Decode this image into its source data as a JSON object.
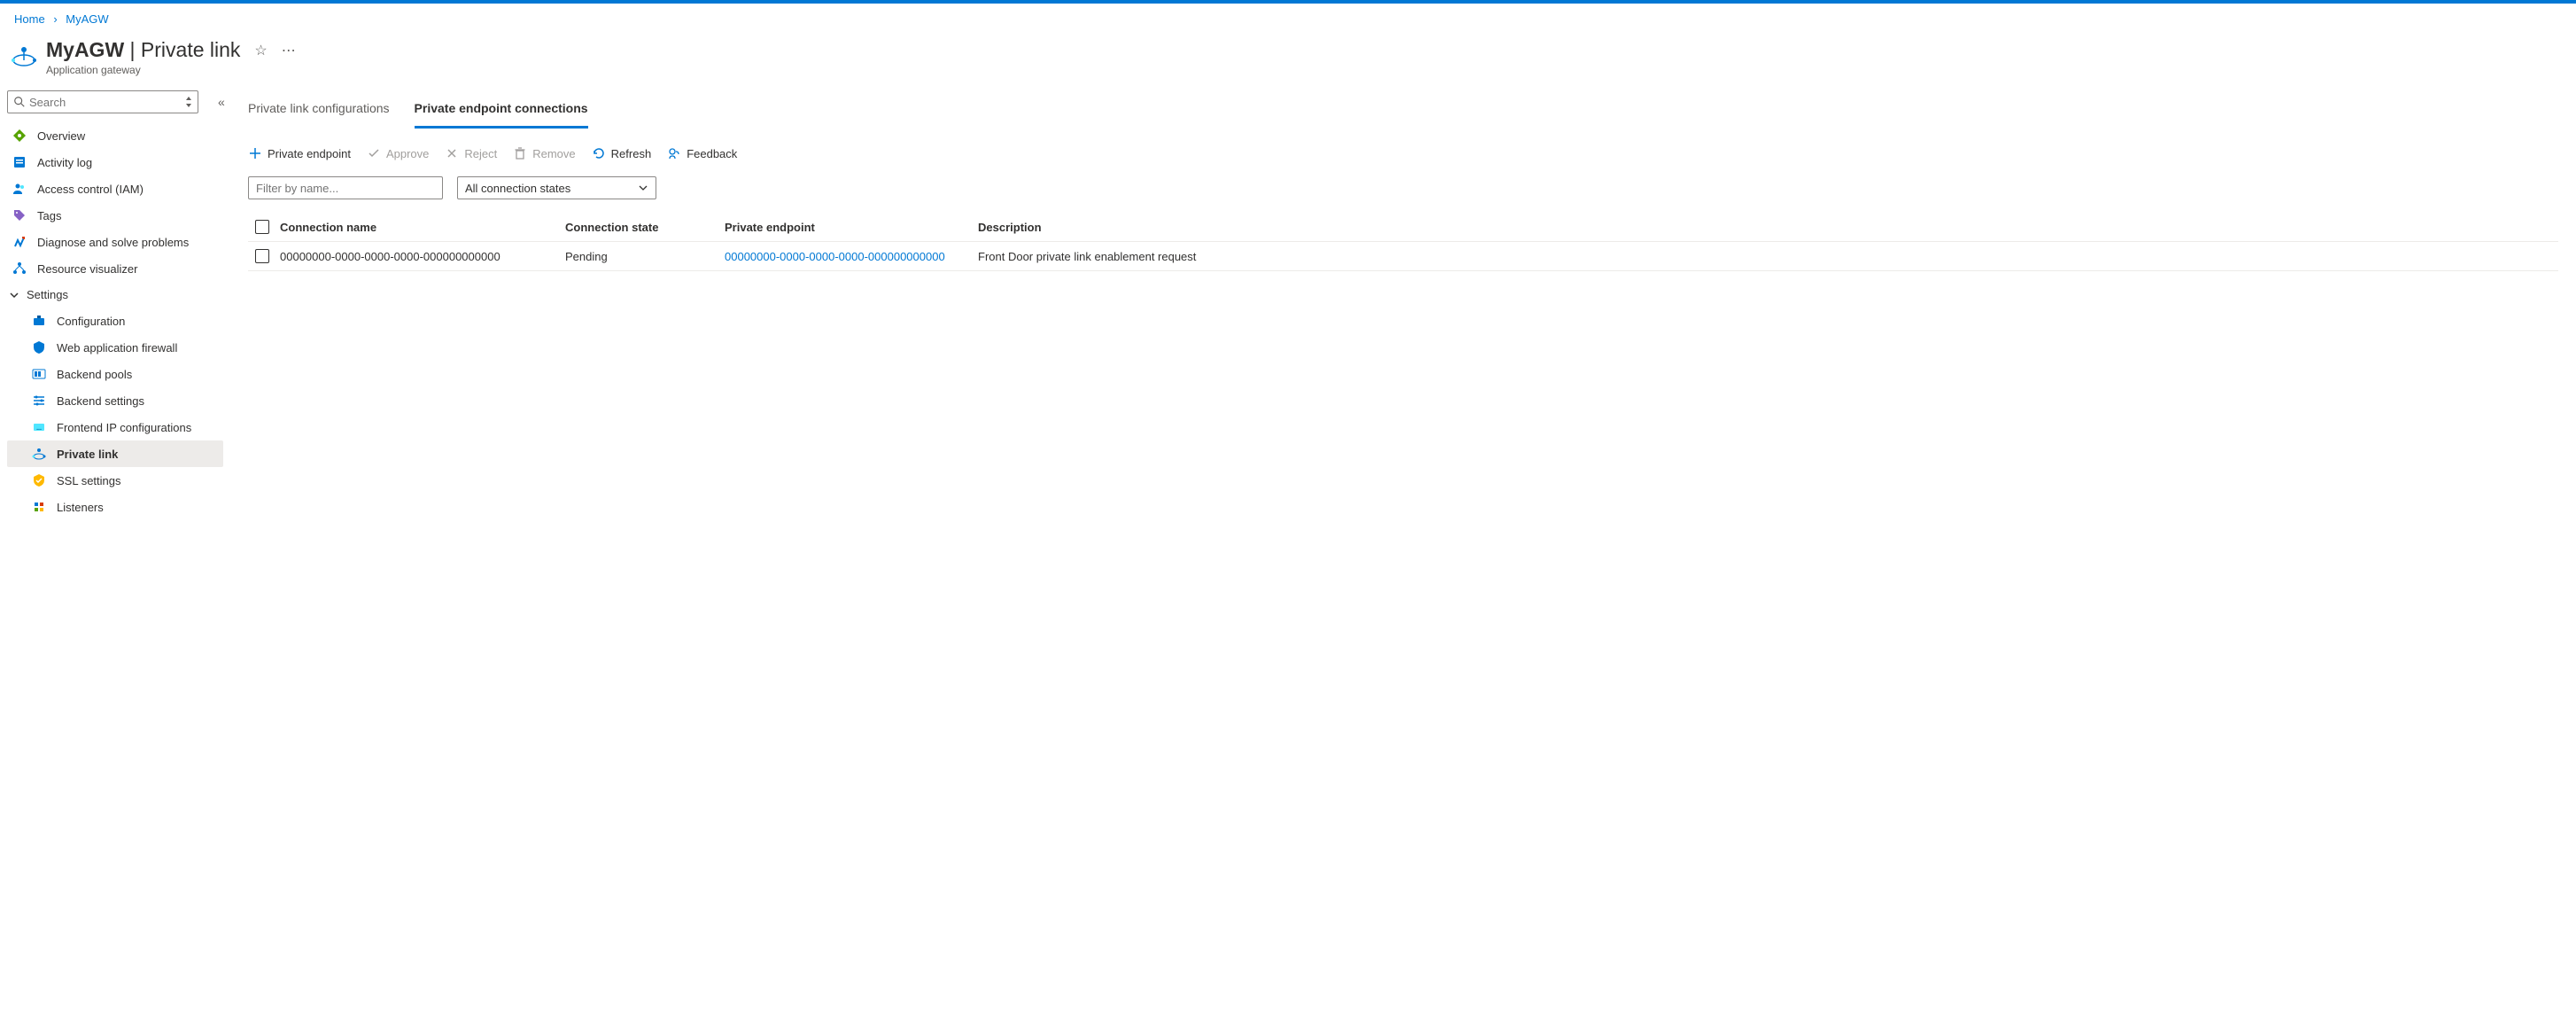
{
  "breadcrumb": {
    "home": "Home",
    "current": "MyAGW"
  },
  "header": {
    "title_bold": "MyAGW",
    "title_suffix": " | Private link",
    "subtitle": "Application gateway"
  },
  "sidebar": {
    "search_placeholder": "Search",
    "items": [
      {
        "label": "Overview"
      },
      {
        "label": "Activity log"
      },
      {
        "label": "Access control (IAM)"
      },
      {
        "label": "Tags"
      },
      {
        "label": "Diagnose and solve problems"
      },
      {
        "label": "Resource visualizer"
      }
    ],
    "group_label": "Settings",
    "subitems": [
      {
        "label": "Configuration"
      },
      {
        "label": "Web application firewall"
      },
      {
        "label": "Backend pools"
      },
      {
        "label": "Backend settings"
      },
      {
        "label": "Frontend IP configurations"
      },
      {
        "label": "Private link"
      },
      {
        "label": "SSL settings"
      },
      {
        "label": "Listeners"
      }
    ]
  },
  "tabs": {
    "configs": "Private link configurations",
    "connections": "Private endpoint connections"
  },
  "toolbar": {
    "add": "Private endpoint",
    "approve": "Approve",
    "reject": "Reject",
    "remove": "Remove",
    "refresh": "Refresh",
    "feedback": "Feedback"
  },
  "filters": {
    "name_placeholder": "Filter by name...",
    "state_label": "All connection states"
  },
  "table": {
    "headers": {
      "name": "Connection name",
      "state": "Connection state",
      "endpoint": "Private endpoint",
      "desc": "Description"
    },
    "rows": [
      {
        "name": "00000000-0000-0000-0000-000000000000",
        "state": "Pending",
        "endpoint": "00000000-0000-0000-0000-000000000000",
        "desc": "Front Door private link enablement request"
      }
    ]
  }
}
